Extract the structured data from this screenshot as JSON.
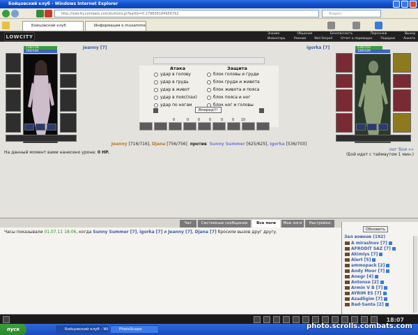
{
  "browser": {
    "window_title": "Бойцовский клуб - Windows Internet Explorer",
    "address": "http://lowcity.combats.com/buttons.pl?battle=0.279606184956762",
    "search_placeholder": "Яндекс",
    "tabs": [
      {
        "label": "Бойцовский клуб",
        "active": true
      },
      {
        "label": "Информация о muxammed",
        "active": false
      }
    ]
  },
  "game_header": {
    "logo": "LOWCITY",
    "nav_top": [
      "Знание",
      "Общение",
      "Безопасность",
      "Персонаж",
      "Выход"
    ],
    "nav_bottom": [
      "Инвентарь",
      "Умения",
      "Noil Serpoll",
      "Отчет о переводах",
      "Подарки",
      "Анкета"
    ]
  },
  "player_left": {
    "name": "Jeanny [7]",
    "hp": "716/716",
    "mp": "184/184"
  },
  "player_right": {
    "name": "igorka [7]",
    "hp": "536/703",
    "mp": "189/189"
  },
  "combat": {
    "attack_title": "Атака",
    "defense_title": "Защита",
    "attack_options": [
      "удар в голову",
      "удар в грудь",
      "удар в живот",
      "удар в пояс(пах)",
      "удар по ногам"
    ],
    "defense_options": [
      "блок головы и груди",
      "блок груди и живота",
      "блок живота и пояса",
      "блок пояса и ног",
      "блок ног и головы"
    ],
    "go_button": "Вперед!!!"
  },
  "stats": [
    "0",
    "0",
    "0",
    "0",
    "0",
    "0",
    "10"
  ],
  "battle_line": {
    "team1": [
      {
        "name": "Jeanny",
        "hp": "[716/716]",
        "color": "#b8752a"
      },
      {
        "name": "Djana",
        "hp": "[756/756]",
        "color": "#b8752a"
      }
    ],
    "versus": "против",
    "team2": [
      {
        "name": "Sunny Summer",
        "hp": "[625/625]",
        "color": "#6e7fd6"
      },
      {
        "name": "igorka",
        "hp": "[536/703]",
        "color": "#6e7fd6"
      }
    ]
  },
  "damage_text_prefix": "На данный момент вами нанесено урона:",
  "damage_value": "0 HP.",
  "log_link": "лог боя »»",
  "timeout_text": "(Бой идет с таймаутом 1 мин.)",
  "chat_tabs": [
    {
      "label": "Чат",
      "active": false
    },
    {
      "label": "Системные сообщения",
      "active": false
    },
    {
      "label": "Все логи",
      "active": true
    },
    {
      "label": "Мои логи",
      "active": false
    },
    {
      "label": "Настройки",
      "active": false
    }
  ],
  "chat": {
    "prefix": "Часы показывали",
    "time": "01.07.11 18:06",
    "mid": ", когда",
    "n1": "Sunny Summer [7]",
    "n2": "igorka [7]",
    "and1": "и",
    "n3": "Jeanny [7]",
    "n4": "Djana [7]",
    "suffix": "бросили вызов друг другу."
  },
  "roster": {
    "refresh_button": "Обновить",
    "title": "Зал воинов (192)",
    "items": [
      "A miraslnov [7]",
      "AFRODIT SAZ [7]",
      "Akimiys [7]",
      "Alert [5]",
      "ammopack [2]",
      "Andy Moor [7]",
      "Anegr [4]",
      "Antonse [2]",
      "Armin V B [7]",
      "AYRIM ES [7]",
      "Azadligim [7]",
      "Bad-Santa [2]"
    ]
  },
  "clock": "18:07",
  "taskbar": {
    "start": "пуск",
    "tasks": [
      {
        "label": "Бойцовский клуб - Wi...",
        "active": true
      },
      {
        "label": "PhotoScape",
        "active": false
      }
    ]
  },
  "watermark": "photo.scrolls.combats.com"
}
